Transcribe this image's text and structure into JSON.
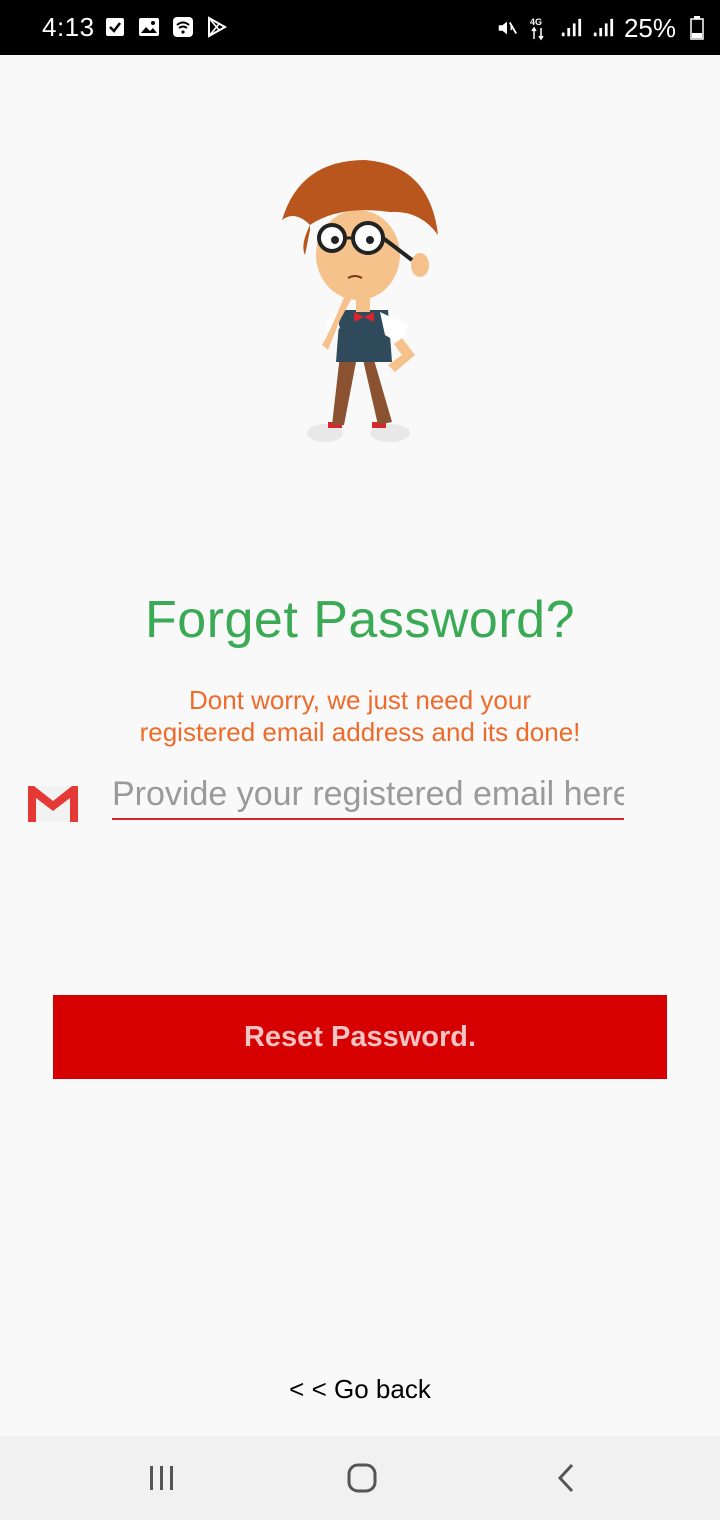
{
  "status_bar": {
    "time": "4:13",
    "battery_percent": "25%",
    "network": "4G",
    "icons": [
      "checkbox-icon",
      "image-icon",
      "wifi-icon",
      "play-store-icon",
      "mute-icon",
      "signal-icon",
      "battery-icon"
    ]
  },
  "main": {
    "title": "Forget Password?",
    "subtitle_line1": "Dont worry, we just need your",
    "subtitle_line2": "registered email address and its done!",
    "email_placeholder": "Provide your registered email here",
    "email_value": "",
    "reset_button": "Reset Password.",
    "go_back": "< < Go back"
  },
  "colors": {
    "title": "#3aaa55",
    "subtitle": "#ee6b2a",
    "button_bg": "#d60000",
    "underline": "#d9252b"
  }
}
